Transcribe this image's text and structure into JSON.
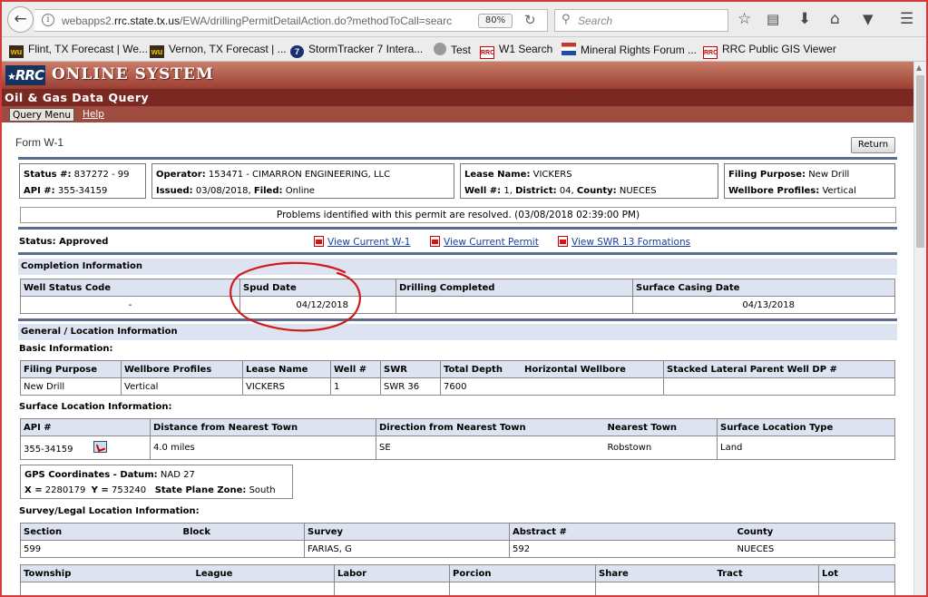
{
  "browser": {
    "url_prefix": "webapps2.",
    "url_domain": "rrc.state.tx.us",
    "url_path": "/EWA/drillingPermitDetailAction.do?methodToCall=searc",
    "zoom": "80%",
    "search_placeholder": "Search",
    "icons": [
      "back-arrow-icon",
      "info-icon",
      "reload-icon",
      "search-icon",
      "star-icon",
      "reading-list-icon",
      "download-icon",
      "home-icon",
      "pocket-icon",
      "menu-icon"
    ],
    "bookmarks": [
      {
        "label": "Flint, TX Forecast | We...",
        "icon": "wu-icon"
      },
      {
        "label": "Vernon, TX Forecast | ...",
        "icon": "wu-icon"
      },
      {
        "label": "StormTracker 7 Intera...",
        "icon": "channel7-icon"
      },
      {
        "label": "Test",
        "icon": "globe-icon"
      },
      {
        "label": "W1 Search",
        "icon": "rrc-icon"
      },
      {
        "label": "Mineral Rights Forum ...",
        "icon": "flag-icon"
      },
      {
        "label": "RRC Public GIS Viewer",
        "icon": "rrc-icon"
      }
    ]
  },
  "header": {
    "logo": "RRC",
    "system_name": "ONLINE SYSTEM",
    "app_title": "Oil & Gas Data Query",
    "menu": {
      "query_menu": "Query Menu",
      "help": "Help"
    }
  },
  "form": {
    "title": "Form W-1",
    "return_button": "Return",
    "status_box": {
      "status_label": "Status #:",
      "status_value": "837272 - 99",
      "api_label": "API #:",
      "api_value": "355-34159"
    },
    "operator_box": {
      "operator_label": "Operator:",
      "operator_value": "153471 - CIMARRON ENGINEERING, LLC",
      "issued_label": "Issued:",
      "issued_value": "03/08/2018",
      "filed_label": "Filed:",
      "filed_value": "Online"
    },
    "lease_box": {
      "lease_label": "Lease Name:",
      "lease_value": "VICKERS",
      "well_label": "Well #:",
      "well_value": "1",
      "district_label": "District:",
      "district_value": "04",
      "county_label": "County:",
      "county_value": "NUECES"
    },
    "filing_box": {
      "purpose_label": "Filing Purpose:",
      "purpose_value": "New Drill",
      "profiles_label": "Wellbore Profiles:",
      "profiles_value": "Vertical"
    },
    "message": "Problems identified with this permit are resolved. (03/08/2018 02:39:00 PM)",
    "status_line": "Status: Approved",
    "links": [
      "View Current W-1",
      "View Current Permit",
      "View SWR 13 Formations"
    ],
    "completion": {
      "title": "Completion Information",
      "headers": [
        "Well Status Code",
        "Spud Date",
        "Drilling Completed",
        "Surface Casing Date"
      ],
      "row": [
        "-",
        "04/12/2018",
        "",
        "04/13/2018"
      ]
    },
    "general": {
      "title": "General / Location Information",
      "basic_label": "Basic Information:",
      "basic_headers": [
        "Filing Purpose",
        "Wellbore Profiles",
        "Lease Name",
        "Well #",
        "SWR",
        "Total Depth",
        "Horizontal Wellbore",
        "Stacked Lateral Parent Well DP #"
      ],
      "basic_row": [
        "New Drill",
        "Vertical",
        "VICKERS",
        "1",
        "SWR 36",
        "7600",
        "",
        ""
      ],
      "surface_label": "Surface Location Information:",
      "surface_headers": [
        "API #",
        "Distance from Nearest Town",
        "Direction from Nearest Town",
        "Nearest Town",
        "Surface Location Type"
      ],
      "surface_row": [
        "355-34159",
        "4.0 miles",
        "SE",
        "Robstown",
        "Land"
      ],
      "gps": {
        "label": "GPS Coordinates - Datum:",
        "datum": "NAD 27",
        "x_label": "X =",
        "x_value": "2280179",
        "y_label": "Y =",
        "y_value": "753240",
        "zone_label": "State Plane Zone:",
        "zone_value": "South"
      },
      "survey_label": "Survey/Legal Location Information:",
      "survey_headers": [
        "Section",
        "Block",
        "Survey",
        "Abstract #",
        "County"
      ],
      "survey_row": [
        "599",
        "",
        "FARIAS, G",
        "592",
        "NUECES"
      ],
      "township_headers": [
        "Township",
        "League",
        "Labor",
        "Porcion",
        "Share",
        "Tract",
        "Lot"
      ]
    }
  },
  "annotation": {
    "color": "#d11a1a"
  }
}
